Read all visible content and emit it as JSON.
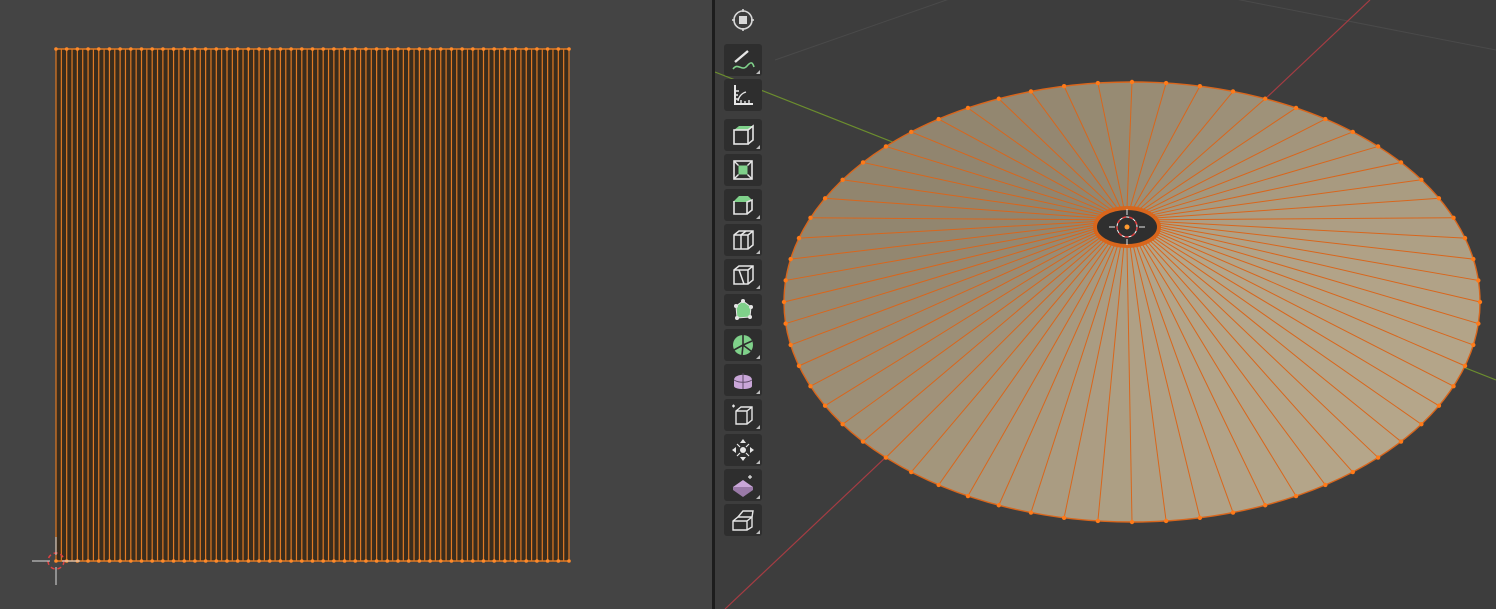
{
  "uv_editor": {
    "mesh_color": "#e07a24",
    "fill_color": "#3a2c1c",
    "vertex_color": "#ff8a2a",
    "columns": 96
  },
  "viewport": {
    "background": "#3d3d3d",
    "face_color": "#b5a68a",
    "edge_color": "#d9661c",
    "axis_x_color": "#a53c43",
    "axis_y_color": "#6c8e2e",
    "segments": 64
  },
  "toolbar": {
    "tools": [
      {
        "name": "tool-pivot",
        "icon": "pivot-icon"
      },
      {
        "name": "tool-annotate",
        "icon": "annotate-icon"
      },
      {
        "name": "tool-measure",
        "icon": "measure-icon"
      },
      {
        "name": "tool-extrude-region",
        "icon": "extrude-region-icon"
      },
      {
        "name": "tool-inset-faces",
        "icon": "inset-faces-icon"
      },
      {
        "name": "tool-bevel",
        "icon": "bevel-icon"
      },
      {
        "name": "tool-loop-cut",
        "icon": "loop-cut-icon"
      },
      {
        "name": "tool-knife",
        "icon": "knife-icon"
      },
      {
        "name": "tool-poly-build",
        "icon": "poly-build-icon"
      },
      {
        "name": "tool-spin",
        "icon": "spin-icon"
      },
      {
        "name": "tool-smooth",
        "icon": "smooth-icon"
      },
      {
        "name": "tool-edge-slide",
        "icon": "edge-slide-icon"
      },
      {
        "name": "tool-shrink-fatten",
        "icon": "shrink-fatten-icon"
      },
      {
        "name": "tool-shear",
        "icon": "shear-icon"
      },
      {
        "name": "tool-rip-region",
        "icon": "rip-region-icon"
      }
    ]
  }
}
